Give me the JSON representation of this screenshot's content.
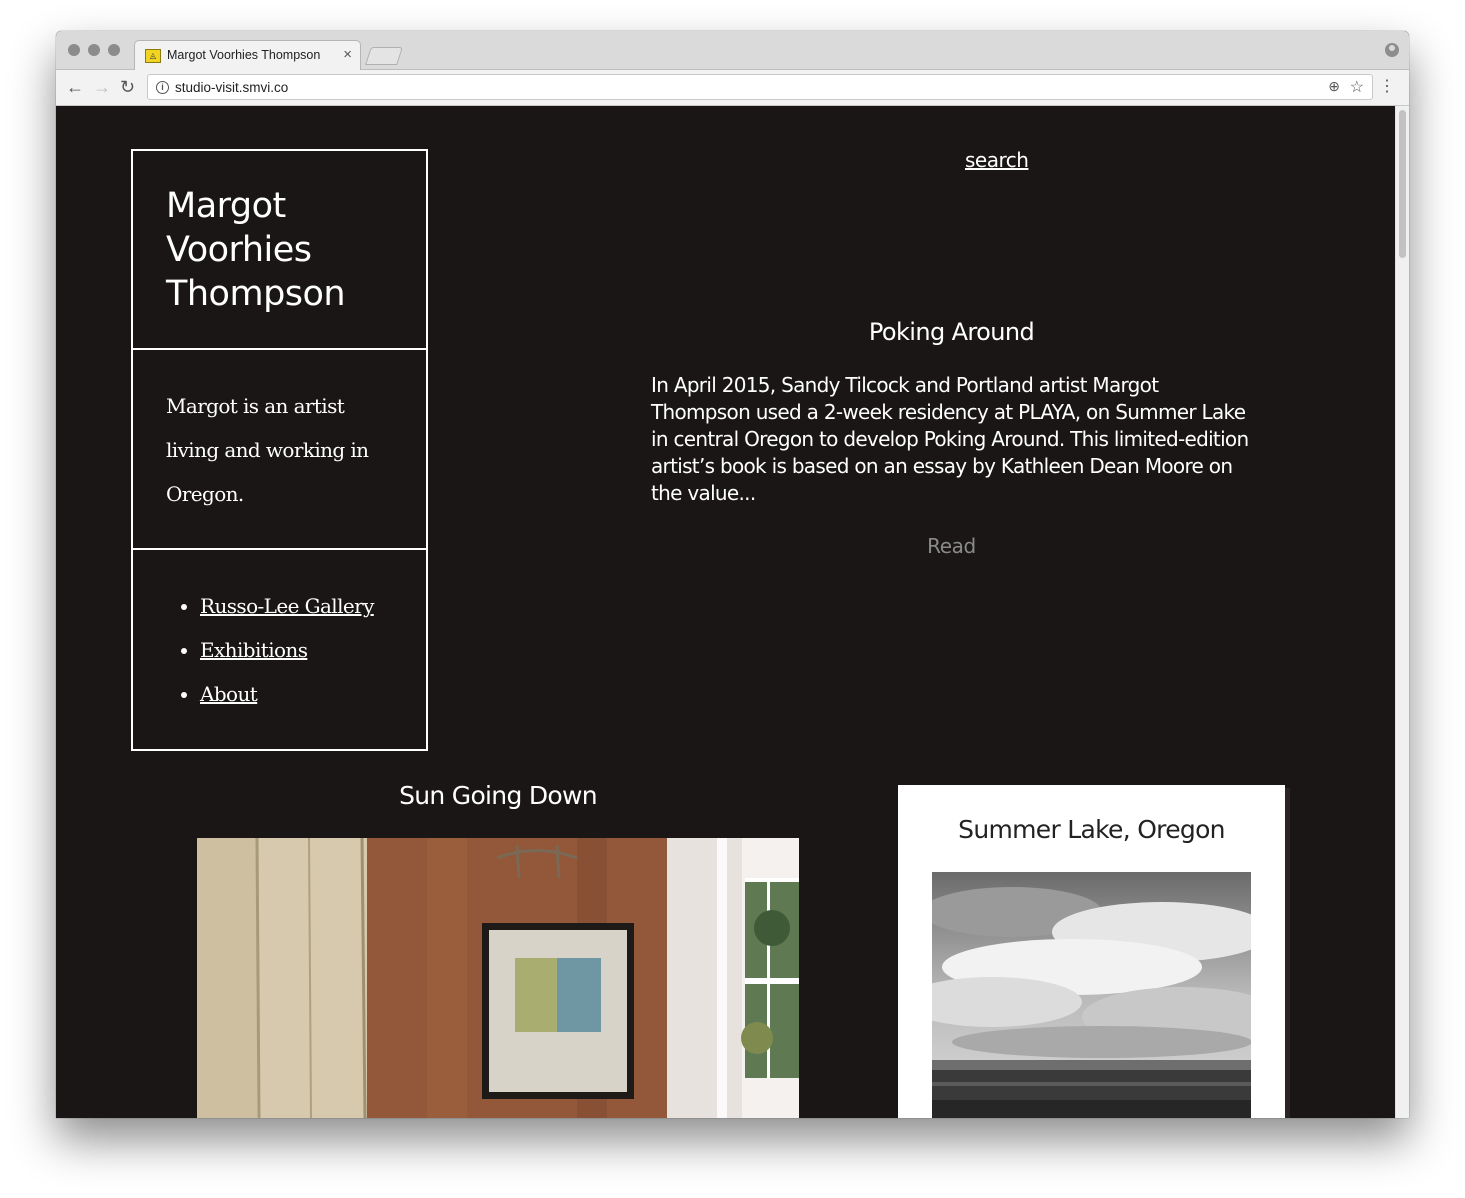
{
  "browser": {
    "tab_title": "Margot Voorhies Thompson",
    "url": "studio-visit.smvi.co",
    "nav_back": "←",
    "nav_forward": "→",
    "reload": "↻",
    "zoom": "⊕",
    "star": "☆",
    "menu": "⋮",
    "tab_close": "×"
  },
  "sidebar": {
    "site_title": "Margot Voorhies Thompson",
    "bio": "Margot is an artist living and working in Oregon.",
    "nav": [
      {
        "label": "Russo-Lee Gallery"
      },
      {
        "label": "Exhibitions"
      },
      {
        "label": "About"
      }
    ]
  },
  "header": {
    "search_label": "search"
  },
  "featured_post": {
    "title": "Poking Around",
    "excerpt": "In April 2015, Sandy Tilcock and Portland artist Margot Thompson used a 2-week residency at PLAYA, on Summer Lake in central Oregon to develop Poking Around. This limited-edition artist’s book is based on an essay by Kathleen Dean Moore on the value...",
    "read_label": "Read"
  },
  "cards": [
    {
      "title": "Sun Going Down",
      "image_icon": "interior-painting-photo"
    },
    {
      "title": "Summer Lake, Oregon",
      "image_icon": "landscape-bw-photo"
    }
  ],
  "colors": {
    "background": "#1a1616",
    "text": "#ffffff",
    "read_link": "#8a8a8a",
    "card_background": "#ffffff"
  }
}
